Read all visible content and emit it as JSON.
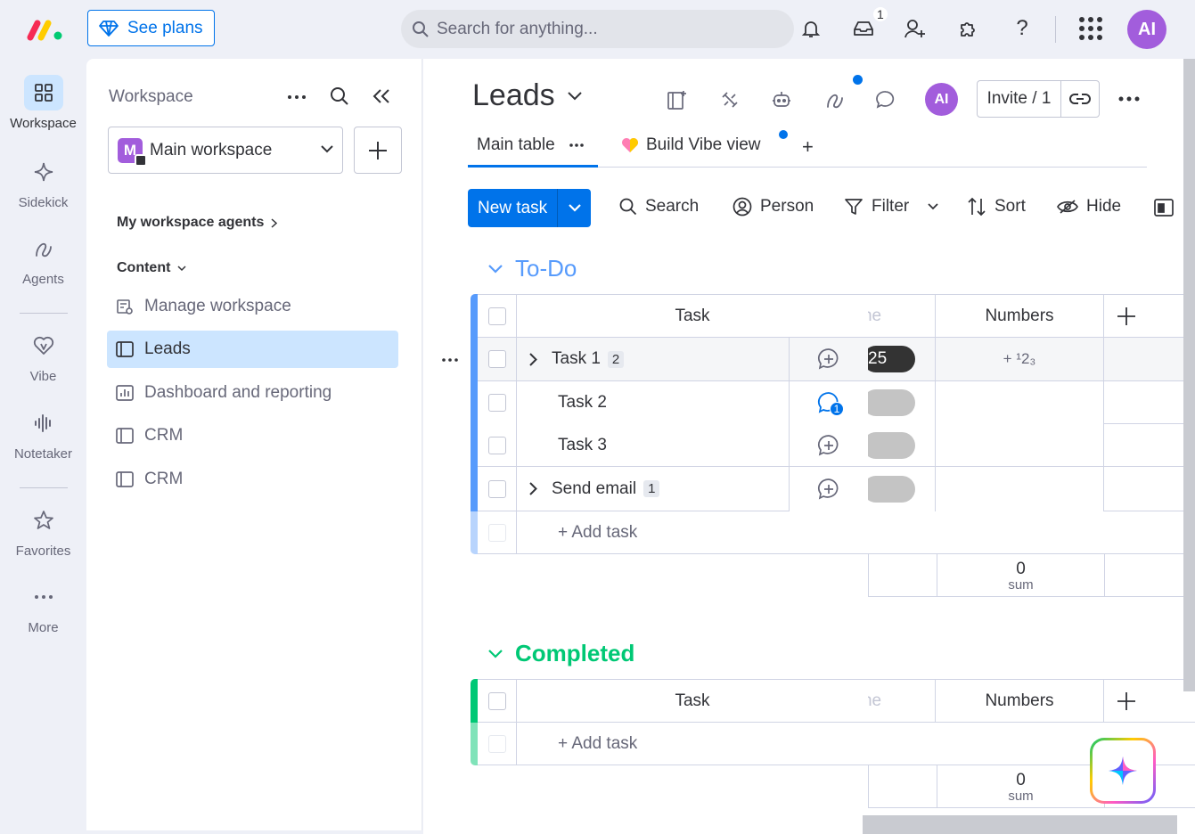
{
  "topbar": {
    "see_plans": "See plans",
    "search_placeholder": "Search for anything...",
    "inbox_badge": "1",
    "avatar": "AI"
  },
  "rail": {
    "items": [
      {
        "label": "Workspace",
        "icon": "grid-icon"
      },
      {
        "label": "Sidekick",
        "icon": "sparkle-icon"
      },
      {
        "label": "Agents",
        "icon": "agent-icon"
      },
      {
        "label": "Vibe",
        "icon": "heart-icon"
      },
      {
        "label": "Notetaker",
        "icon": "waveform-icon"
      },
      {
        "label": "Favorites",
        "icon": "star-icon"
      },
      {
        "label": "More",
        "icon": "more-dots-icon"
      }
    ]
  },
  "workspace": {
    "title": "Workspace",
    "selected": "Main workspace",
    "selected_initial": "M",
    "agents_link": "My workspace agents",
    "content_label": "Content",
    "items": [
      {
        "label": "Manage workspace"
      },
      {
        "label": "Leads"
      },
      {
        "label": "Dashboard and reporting"
      },
      {
        "label": "CRM"
      },
      {
        "label": "CRM"
      }
    ]
  },
  "board": {
    "title": "Leads",
    "avatar": "AI",
    "invite": "Invite / 1",
    "tabs": {
      "main": "Main table",
      "vibe": "Build Vibe view",
      "add": "+"
    },
    "toolbar": {
      "new_task": "New task",
      "search": "Search",
      "person": "Person",
      "filter": "Filter",
      "sort": "Sort",
      "hide": "Hide"
    },
    "columns": {
      "task": "Task",
      "timeline": "Timeline",
      "numbers": "Numbers"
    },
    "groups": [
      {
        "title": "To-Do",
        "color": "#579bfc",
        "rows": [
          {
            "name": "Task 1",
            "subitems": "2",
            "timeline": "25",
            "numbers": "+ ¹2₃"
          },
          {
            "name": "Task 2",
            "subitems": "",
            "updates": "1"
          },
          {
            "name": "Task 3",
            "subitems": ""
          },
          {
            "name": "Send email",
            "subitems": "1"
          }
        ],
        "add_task": "+ Add task",
        "sum_value": "0",
        "sum_label": "sum"
      },
      {
        "title": "Completed",
        "color": "#00c875",
        "rows": [],
        "add_task": "+ Add task",
        "sum_value": "0",
        "sum_label": "sum"
      }
    ]
  },
  "colors": {
    "primary": "#0073ea",
    "todo": "#579bfc",
    "done": "#00c875",
    "avatar": "#a25ddc"
  }
}
